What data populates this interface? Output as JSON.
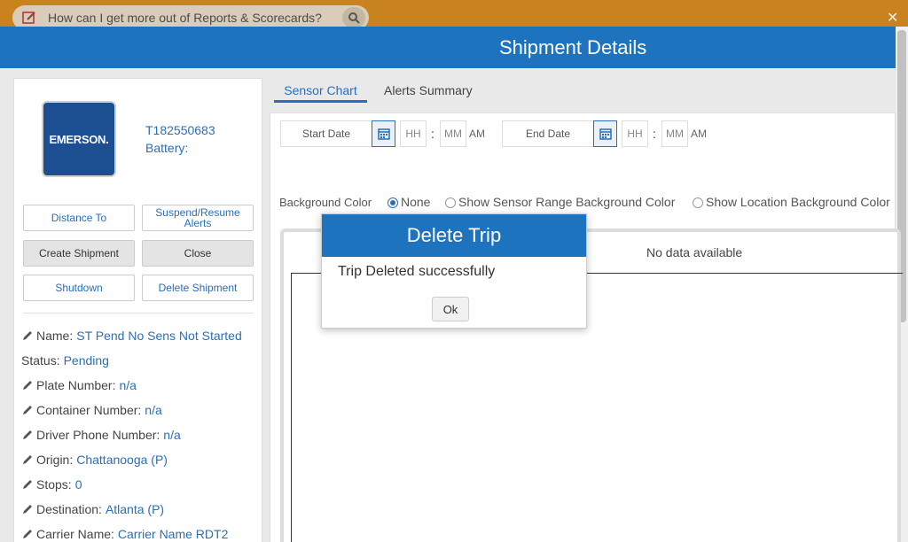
{
  "help_bar": {
    "question": "How can I get more out of Reports & Scorecards?",
    "edit_icon": "edit-icon",
    "search_icon": "search-icon",
    "close_icon": "close-icon"
  },
  "header": {
    "title": "Shipment Details"
  },
  "device": {
    "logo_text": "EMERSON.",
    "id": "T182550683",
    "battery_label": "Battery:"
  },
  "actions": {
    "distance_to": "Distance To",
    "suspend_resume": "Suspend/Resume Alerts",
    "create_shipment": "Create Shipment",
    "close": "Close",
    "shutdown": "Shutdown",
    "delete_shipment": "Delete Shipment"
  },
  "info": {
    "name_label": "Name:",
    "name_value": "ST Pend No Sens Not Started",
    "status_label": "Status:",
    "status_value": "Pending",
    "plate_label": "Plate Number:",
    "plate_value": "n/a",
    "container_label": "Container Number:",
    "container_value": "n/a",
    "driver_label": "Driver Phone Number:",
    "driver_value": "n/a",
    "origin_label": "Origin:",
    "origin_value": "Chattanooga (P)",
    "stops_label": "Stops:",
    "stops_value": "0",
    "destination_label": "Destination:",
    "destination_value": "Atlanta (P)",
    "carrier_label": "Carrier Name:",
    "carrier_value": "Carrier Name RDT2"
  },
  "tabs": {
    "sensor_chart": "Sensor Chart",
    "alerts_summary": "Alerts Summary"
  },
  "filters": {
    "start_date": "Start Date",
    "end_date": "End Date",
    "hh": "HH",
    "mm": "MM",
    "colon": ":",
    "ampm": "AM"
  },
  "background": {
    "label": "Background Color",
    "options": [
      "None",
      "Show Sensor Range Background Color",
      "Show Location Background Color"
    ],
    "selected": "None"
  },
  "chart": {
    "no_data": "No data available"
  },
  "dialog": {
    "title": "Delete Trip",
    "message": "Trip Deleted successfully",
    "ok": "Ok"
  },
  "colors": {
    "header": "#1d73be",
    "topbar": "#c8831e",
    "link": "#2a6ebb"
  }
}
